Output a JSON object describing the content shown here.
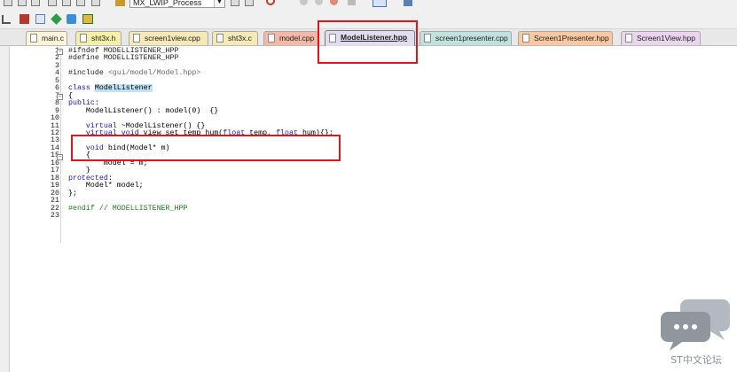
{
  "toolbar": {
    "project_combo_value": "MX_LWIP_Process"
  },
  "tabs": [
    {
      "label": "main.c",
      "color": "#fdf4d8",
      "active": false
    },
    {
      "label": "sht3x.h",
      "color": "#f6efaa",
      "active": false
    },
    {
      "label": "screen1view.cpp",
      "color": "#f5e9b5",
      "active": false
    },
    {
      "label": "sht3x.c",
      "color": "#f5e9b5",
      "active": false
    },
    {
      "label": "model.cpp",
      "color": "#f3b9a7",
      "active": false
    },
    {
      "label": "ModelListener.hpp",
      "color": "#e1dcef",
      "active": true
    },
    {
      "label": "screen1presenter.cpp",
      "color": "#bfe3dc",
      "active": false
    },
    {
      "label": "Screen1Presenter.hpp",
      "color": "#f8c9a0",
      "active": false
    },
    {
      "label": "Screen1View.hpp",
      "color": "#ead4ee",
      "active": false
    }
  ],
  "code": {
    "line_numbers": [
      "1",
      "2",
      "3",
      "4",
      "5",
      "6",
      "7",
      "8",
      "9",
      "10",
      "11",
      "12",
      "13",
      "14",
      "15",
      "16",
      "17",
      "18",
      "19",
      "20",
      "21",
      "22",
      "23"
    ],
    "lines": [
      {
        "segments": [
          {
            "t": "#ifndef MODELLISTENER_HPP",
            "c": "pp"
          }
        ]
      },
      {
        "segments": [
          {
            "t": "#define MODELLISTENER_HPP",
            "c": "pp"
          }
        ]
      },
      {
        "segments": []
      },
      {
        "segments": [
          {
            "t": "#include ",
            "c": "pp"
          },
          {
            "t": "<gui/model/Model.hpp>",
            "c": "inc"
          }
        ]
      },
      {
        "segments": []
      },
      {
        "segments": [
          {
            "t": "class",
            "c": "kw"
          },
          {
            "t": " ",
            "c": ""
          },
          {
            "t": "ModelListener",
            "c": "hl"
          }
        ]
      },
      {
        "segments": [
          {
            "t": "{",
            "c": ""
          }
        ]
      },
      {
        "segments": [
          {
            "t": "public",
            "c": "kw"
          },
          {
            "t": ":",
            "c": ""
          }
        ]
      },
      {
        "segments": [
          {
            "t": "    ModelListener() : model(0)  {}",
            "c": ""
          }
        ]
      },
      {
        "segments": []
      },
      {
        "segments": [
          {
            "t": "    ",
            "c": ""
          },
          {
            "t": "virtual",
            "c": "kw"
          },
          {
            "t": " ~ModelListener() {}",
            "c": ""
          }
        ]
      },
      {
        "segments": [
          {
            "t": "    ",
            "c": ""
          },
          {
            "t": "virtual",
            "c": "kw"
          },
          {
            "t": " ",
            "c": ""
          },
          {
            "t": "void",
            "c": "kw"
          },
          {
            "t": " view_set_temp_hum(",
            "c": ""
          },
          {
            "t": "float",
            "c": "kw"
          },
          {
            "t": " temp, ",
            "c": ""
          },
          {
            "t": "float",
            "c": "kw"
          },
          {
            "t": " hum){};",
            "c": ""
          }
        ]
      },
      {
        "segments": []
      },
      {
        "segments": [
          {
            "t": "    ",
            "c": ""
          },
          {
            "t": "void",
            "c": "kw"
          },
          {
            "t": " bind(Model* m)",
            "c": ""
          }
        ]
      },
      {
        "segments": [
          {
            "t": "    {",
            "c": ""
          }
        ]
      },
      {
        "segments": [
          {
            "t": "        model = m;",
            "c": ""
          }
        ]
      },
      {
        "segments": [
          {
            "t": "    }",
            "c": ""
          }
        ]
      },
      {
        "segments": [
          {
            "t": "protected",
            "c": "kw"
          },
          {
            "t": ":",
            "c": ""
          }
        ]
      },
      {
        "segments": [
          {
            "t": "    Model* model;",
            "c": ""
          }
        ]
      },
      {
        "segments": [
          {
            "t": "};",
            "c": ""
          }
        ]
      },
      {
        "segments": []
      },
      {
        "segments": [
          {
            "t": "#endif // MODELLISTENER_HPP",
            "c": "cm"
          }
        ]
      },
      {
        "segments": []
      }
    ]
  },
  "watermark": {
    "text": "ST中文论坛",
    "color": "#a5acb4"
  }
}
